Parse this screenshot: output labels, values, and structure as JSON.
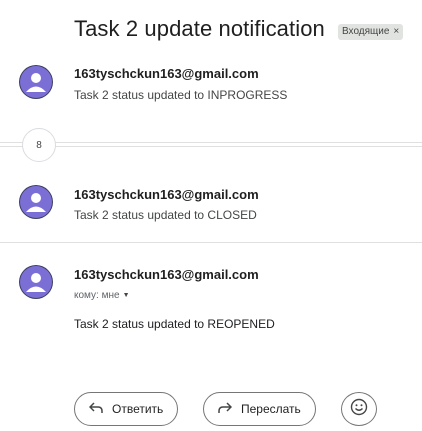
{
  "thread": {
    "subject": "Task 2 update notification",
    "label": "Входящие",
    "label_remove": "×",
    "collapsed_count": "8"
  },
  "messages": [
    {
      "sender": "163tyschckun163@gmail.com",
      "snippet": "Task 2 status updated to INPROGRESS"
    },
    {
      "sender": "163tyschckun163@gmail.com",
      "snippet": "Task 2 status updated to CLOSED"
    },
    {
      "sender": "163tyschckun163@gmail.com",
      "to": "кому: мне",
      "to_caret": "▼",
      "body": "Task 2 status updated to REOPENED"
    }
  ],
  "actions": {
    "reply_label": "Ответить",
    "reply_icon": "reply-icon",
    "forward_label": "Переслать",
    "forward_icon": "forward-icon",
    "emoji_icon": "emoji-reaction-icon"
  },
  "colors": {
    "avatar_back": "#3b3f5e",
    "avatar_front": "#7b6fd6",
    "avatar_head": "#ffffff",
    "label_bg": "#e1e3e1"
  }
}
